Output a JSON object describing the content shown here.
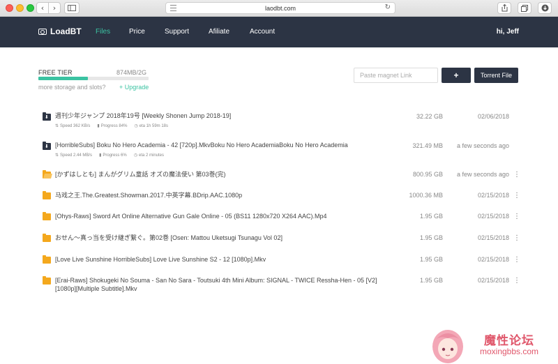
{
  "browser": {
    "url": "laodbt.com",
    "back_icon": "‹",
    "forward_icon": "›",
    "reload_icon": "↻"
  },
  "nav": {
    "brand": "LoadBT",
    "items": [
      "Files",
      "Price",
      "Support",
      "Afiliate",
      "Account"
    ],
    "active_index": 0,
    "greeting": "hi, Jeff"
  },
  "storage": {
    "tier": "FREE TIER",
    "used": "874MB/2G",
    "used_fraction": 0.45,
    "more_text": "more storage and slots?",
    "upgrade_label": "+ Upgrade"
  },
  "actions": {
    "magnet_placeholder": "Paste magnet Link",
    "add_label": "+",
    "torrent_label": "Torrent File"
  },
  "colors": {
    "navbar": "#2c3444",
    "accent": "#3bc3a2",
    "folder": "#f4a81d",
    "watermark": "#e0576b"
  },
  "files": [
    {
      "icon": "download-folder-icon",
      "name": "週刊少年ジャンプ 2018年19号 [Weekly Shonen Jump 2018-19]",
      "size": "32.22 GB",
      "date": "02/06/2018",
      "speed": "Speed 362 KB/s",
      "progress": "Progress 84%",
      "eta": "eta 1h 59m 18s"
    },
    {
      "icon": "download-folder-icon",
      "name": "[HorribleSubs] Boku No Hero Academia - 42 [720p].MkvBoku No Hero AcademiaBoku No Hero Academia",
      "size": "321.49 MB",
      "date": "a few seconds ago",
      "speed": "Speed 2.44 MB/s",
      "progress": "Progress 6%",
      "eta": "eta 2 minutes"
    },
    {
      "icon": "open-folder-icon",
      "name": "[かずはしとも] まんがグリム童話 オズの魔法使い 第03巻(完)",
      "size": "800.95 GB",
      "date": "a few seconds ago",
      "kebab": "⋮"
    },
    {
      "icon": "folder-icon",
      "name": "马戏之王.The.Greatest.Showman.2017.中英字幕.BDrip.AAC.1080p",
      "size": "1000.36 MB",
      "date": "02/15/2018",
      "kebab": "⋮"
    },
    {
      "icon": "folder-icon",
      "name": "[Ohys-Raws] Sword Art Online Alternative Gun Gale Online - 05 (BS11 1280x720 X264 AAC).Mp4",
      "size": "1.95 GB",
      "date": "02/15/2018",
      "kebab": "⋮"
    },
    {
      "icon": "folder-icon",
      "name": "おせん～真っ当を受け継ぎ繋ぐ。第02巻 [Osen: Mattou Uketsugi Tsunagu Vol 02]",
      "size": "1.95 GB",
      "date": "02/15/2018",
      "kebab": "⋮"
    },
    {
      "icon": "folder-icon",
      "name": "[Love Live Sunshine HorribleSubs] Love Live Sunshine S2 - 12 [1080p].Mkv",
      "size": "1.95 GB",
      "date": "02/15/2018",
      "kebab": "⋮"
    },
    {
      "icon": "folder-icon",
      "name": "[Erai-Raws] Shokugeki No Souma - San No Sara - Toutsuki 4th Mini Album: SIGNAL - TWICE Ressha-Hen - 05 [V2] [1080p][Multiple Subtitle].Mkv",
      "size": "1.95 GB",
      "date": "02/15/2018",
      "kebab": "⋮"
    }
  ],
  "watermark": {
    "title": "魔性论坛",
    "url": "moxingbbs.com"
  }
}
